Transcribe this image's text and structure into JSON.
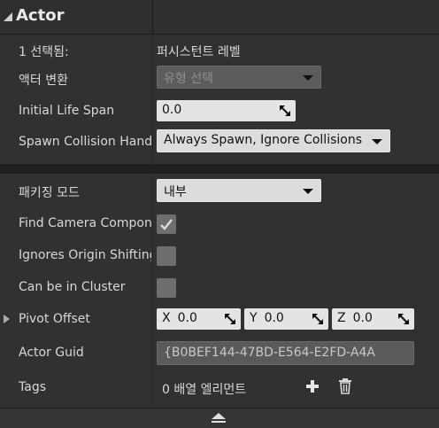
{
  "header": {
    "title": "Actor"
  },
  "rows1": {
    "selected": {
      "label": "1 선택됨:",
      "value": "퍼시스턴트 레벨"
    },
    "transform": {
      "label": "액터 변환",
      "value": "유형 선택"
    },
    "lifespan": {
      "label": "Initial Life Span",
      "value": "0.0"
    },
    "spawn": {
      "label": "Spawn Collision Handling Method",
      "value": "Always Spawn, Ignore Collisions"
    }
  },
  "rows2": {
    "packaging": {
      "label": "패키징 모드",
      "value": "내부"
    },
    "find_camera": {
      "label": "Find Camera Component When View Target",
      "checked": true
    },
    "ignores_origin": {
      "label": "Ignores Origin Shifting",
      "checked": false
    },
    "cluster": {
      "label": "Can be in Cluster",
      "checked": false
    },
    "pivot": {
      "label": "Pivot Offset",
      "x_prefix": "X",
      "x": "0.0",
      "y_prefix": "Y",
      "y": "0.0",
      "z_prefix": "Z",
      "z": "0.0"
    },
    "guid": {
      "label": "Actor Guid",
      "value": "{B0BEF144-47BD-E564-E2FD-A4A"
    },
    "tags": {
      "label": "Tags",
      "value": "0 배열 엘리먼트"
    }
  }
}
